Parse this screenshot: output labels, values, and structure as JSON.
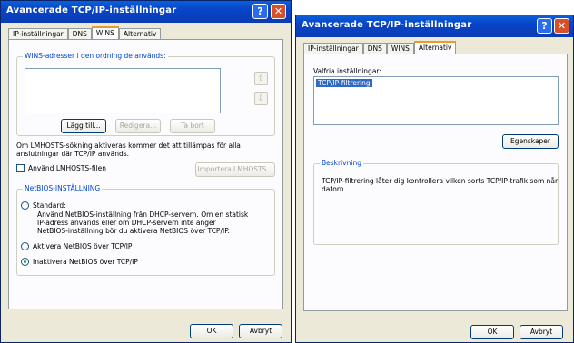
{
  "windows": [
    {
      "title": "Avancerade TCP/IP-inställningar",
      "help_glyph": "?",
      "close_glyph": "✕",
      "tabs": [
        "IP-inställningar",
        "DNS",
        "WINS",
        "Alternativ"
      ],
      "active_tab": "WINS",
      "wins_group_label": "WINS-adresser i den ordning de används:",
      "up_arrow_glyph": "⇧",
      "down_arrow_glyph": "⇩",
      "add_button": "Lägg till...",
      "edit_button": "Redigera...",
      "remove_button": "Ta bort",
      "lmhosts_info": "Om LMHOSTS-sökning aktiveras kommer det att tillämpas för alla anslutningar där TCP/IP används.",
      "lmhosts_checkbox": "Använd LMHOSTS-filen",
      "import_button": "Importera LMHOSTS...",
      "netbios_group_label": "NetBIOS-INSTÄLLNING",
      "radio_standard": "Standard:",
      "standard_desc": [
        "Använd NetBIOS-inställning från DHCP-servern. Om en statisk",
        "IP-adress används eller om DHCP-servern inte anger",
        "NetBIOS-inställning bör du aktivera NetBIOS över TCP/IP."
      ],
      "radio_enable": "Aktivera NetBIOS över TCP/IP",
      "radio_disable": "Inaktivera NetBIOS över TCP/IP",
      "selected_radio": "disable",
      "ok_button": "OK",
      "cancel_button": "Avbryt"
    },
    {
      "title": "Avancerade TCP/IP-inställningar",
      "help_glyph": "?",
      "close_glyph": "✕",
      "tabs": [
        "IP-inställningar",
        "DNS",
        "WINS",
        "Alternativ"
      ],
      "active_tab": "Alternativ",
      "optional_label": "Valfria inställningar:",
      "list_items": [
        "TCP/IP-filtrering"
      ],
      "properties_button": "Egenskaper",
      "description_group_label": "Beskrivning",
      "description_text": [
        "TCP/IP-filtrering låter dig kontrollera vilken sorts TCP/IP-trafik som når",
        "datorn."
      ],
      "ok_button": "OK",
      "cancel_button": "Avbryt"
    }
  ]
}
